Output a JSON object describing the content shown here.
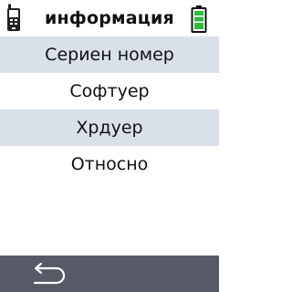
{
  "header": {
    "title": "информация",
    "left_icon": "handheld-device-icon",
    "right_icon": "battery-full-icon"
  },
  "menu": {
    "items": [
      {
        "label": "Сериен номер",
        "shaded": true
      },
      {
        "label": "Софтуер",
        "shaded": false
      },
      {
        "label": "Хрдуер",
        "shaded": true
      },
      {
        "label": "Относно",
        "shaded": false
      }
    ]
  },
  "footer": {
    "back_icon": "back-arrow-icon"
  },
  "colors": {
    "row_shade": "#d9e0ea",
    "footer_bg": "#555a66",
    "battery_green": "#2bbd3a",
    "text": "#111111"
  }
}
